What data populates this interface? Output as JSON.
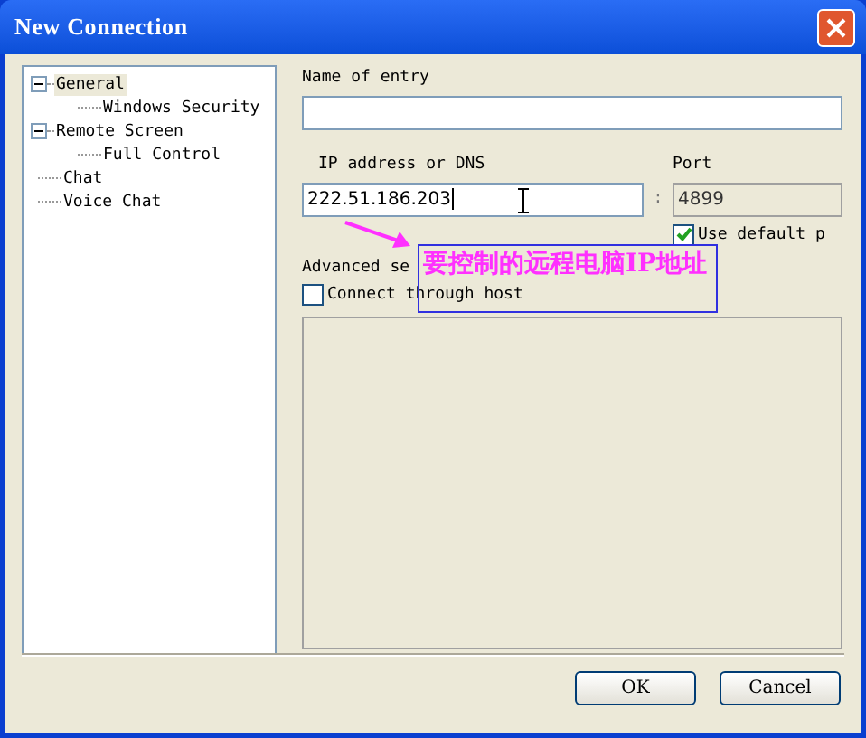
{
  "window": {
    "title": "New Connection"
  },
  "tree": [
    {
      "label": "General",
      "selected": true,
      "expanded": true,
      "children": [
        {
          "label": "Windows Security",
          "selected": false
        }
      ]
    },
    {
      "label": "Remote Screen",
      "selected": false,
      "expanded": true,
      "children": [
        {
          "label": "Full Control",
          "selected": false
        }
      ]
    },
    {
      "label": "Chat",
      "selected": false
    },
    {
      "label": "Voice Chat",
      "selected": false
    }
  ],
  "name_label": "Name of entry",
  "ip_label": "IP address or DNS",
  "ip_value": "222.51.186.203",
  "port_label": "Port",
  "port_value": "4899",
  "port_separator": ":",
  "use_default_port": {
    "label": "Use default p",
    "checked": true
  },
  "advanced_label": "Advanced se",
  "connect_through_host": {
    "label": "Connect through host",
    "checked": false
  },
  "annotation": "要控制的远程电脑IP地址",
  "buttons": [
    "OK",
    "Cancel"
  ]
}
